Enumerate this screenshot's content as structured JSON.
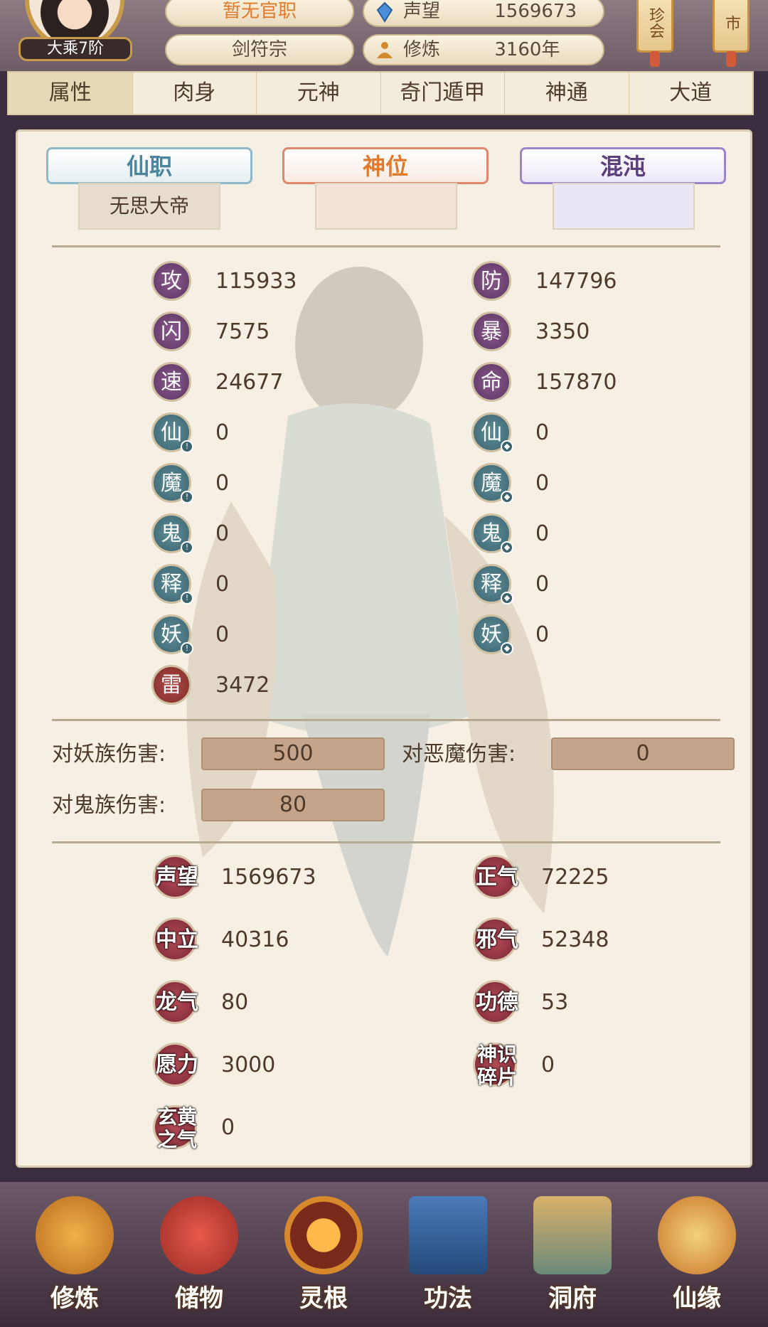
{
  "header": {
    "rank_badge": "大乘7阶",
    "official_title": "暂无官职",
    "sect": "剑符宗",
    "reputation_label": "声望",
    "reputation_value": "1569673",
    "cultivation_label": "修炼",
    "cultivation_value": "3160年",
    "tag_left": "珍会",
    "tag_right": "市"
  },
  "tabs": [
    "属性",
    "肉身",
    "元神",
    "奇门遁甲",
    "神通",
    "大道"
  ],
  "titles": {
    "immortal_post_label": "仙职",
    "immortal_post_value": "无思大帝",
    "divine_position_label": "神位",
    "divine_position_value": "",
    "chaos_label": "混沌",
    "chaos_value": ""
  },
  "attributes_left": [
    {
      "icon": "攻",
      "value": "115933",
      "style": "purple"
    },
    {
      "icon": "闪",
      "value": "7575",
      "style": "purple"
    },
    {
      "icon": "速",
      "value": "24677",
      "style": "purple"
    },
    {
      "icon": "仙",
      "value": "0",
      "style": "teal"
    },
    {
      "icon": "魔",
      "value": "0",
      "style": "teal"
    },
    {
      "icon": "鬼",
      "value": "0",
      "style": "teal"
    },
    {
      "icon": "释",
      "value": "0",
      "style": "teal"
    },
    {
      "icon": "妖",
      "value": "0",
      "style": "teal"
    },
    {
      "icon": "雷",
      "value": "3472",
      "style": "red"
    }
  ],
  "attributes_right": [
    {
      "icon": "防",
      "value": "147796",
      "style": "purple"
    },
    {
      "icon": "暴",
      "value": "3350",
      "style": "purple"
    },
    {
      "icon": "命",
      "value": "157870",
      "style": "purple"
    },
    {
      "icon": "仙",
      "value": "0",
      "style": "teal"
    },
    {
      "icon": "魔",
      "value": "0",
      "style": "teal"
    },
    {
      "icon": "鬼",
      "value": "0",
      "style": "teal"
    },
    {
      "icon": "释",
      "value": "0",
      "style": "teal"
    },
    {
      "icon": "妖",
      "value": "0",
      "style": "teal"
    }
  ],
  "damage": {
    "vs_demon_race_label": "对妖族伤害:",
    "vs_demon_race_value": "500",
    "vs_evil_demon_label": "对恶魔伤害:",
    "vs_evil_demon_value": "0",
    "vs_ghost_label": "对鬼族伤害:",
    "vs_ghost_value": "80"
  },
  "resources_left": [
    {
      "label": "声望",
      "value": "1569673"
    },
    {
      "label": "中立",
      "value": "40316"
    },
    {
      "label": "龙气",
      "value": "80"
    },
    {
      "label": "愿力",
      "value": "3000"
    },
    {
      "label": "玄黄之气",
      "value": "0"
    }
  ],
  "resources_right": [
    {
      "label": "正气",
      "value": "72225"
    },
    {
      "label": "邪气",
      "value": "52348"
    },
    {
      "label": "功德",
      "value": "53"
    },
    {
      "label": "神识碎片",
      "value": "0"
    }
  ],
  "bottom_nav": [
    "修炼",
    "储物",
    "灵根",
    "功法",
    "洞府",
    "仙缘"
  ],
  "colors": {
    "accent_orange": "#e07b2d",
    "tab_active": "#e6d9b6",
    "damage_box": "#c4a58b",
    "resource_icon": "#9b3a45"
  }
}
